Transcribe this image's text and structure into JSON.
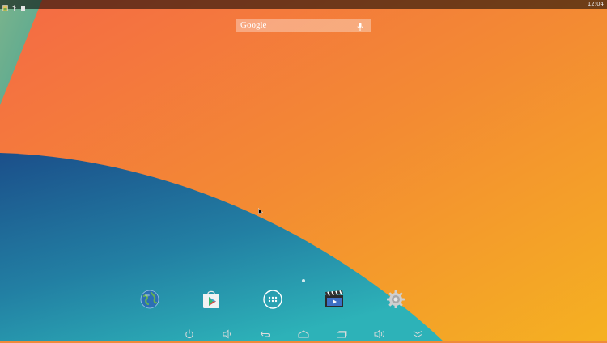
{
  "status_bar": {
    "clock": "12:04",
    "icons": [
      "photo-notification-icon",
      "usb-icon",
      "sd-card-icon"
    ]
  },
  "search_widget": {
    "logo": "Google",
    "mic_icon": "microphone-icon"
  },
  "dock": {
    "apps": [
      {
        "icon": "browser-globe-icon"
      },
      {
        "icon": "play-store-icon"
      },
      {
        "icon": "app-drawer-icon"
      },
      {
        "icon": "video-player-icon"
      },
      {
        "icon": "settings-gear-icon"
      }
    ]
  },
  "navigation_bar": {
    "buttons": [
      {
        "icon": "power-icon"
      },
      {
        "icon": "volume-down-icon"
      },
      {
        "icon": "back-icon"
      },
      {
        "icon": "home-icon"
      },
      {
        "icon": "recent-apps-icon"
      },
      {
        "icon": "volume-up-icon"
      },
      {
        "icon": "hide-bar-icon"
      }
    ]
  },
  "colors": {
    "wallpaper_orange": "#f27a3c",
    "wallpaper_yellow": "#f6ad24",
    "wallpaper_blue": "#1a5f8e",
    "wallpaper_teal": "#2aa3b2"
  }
}
